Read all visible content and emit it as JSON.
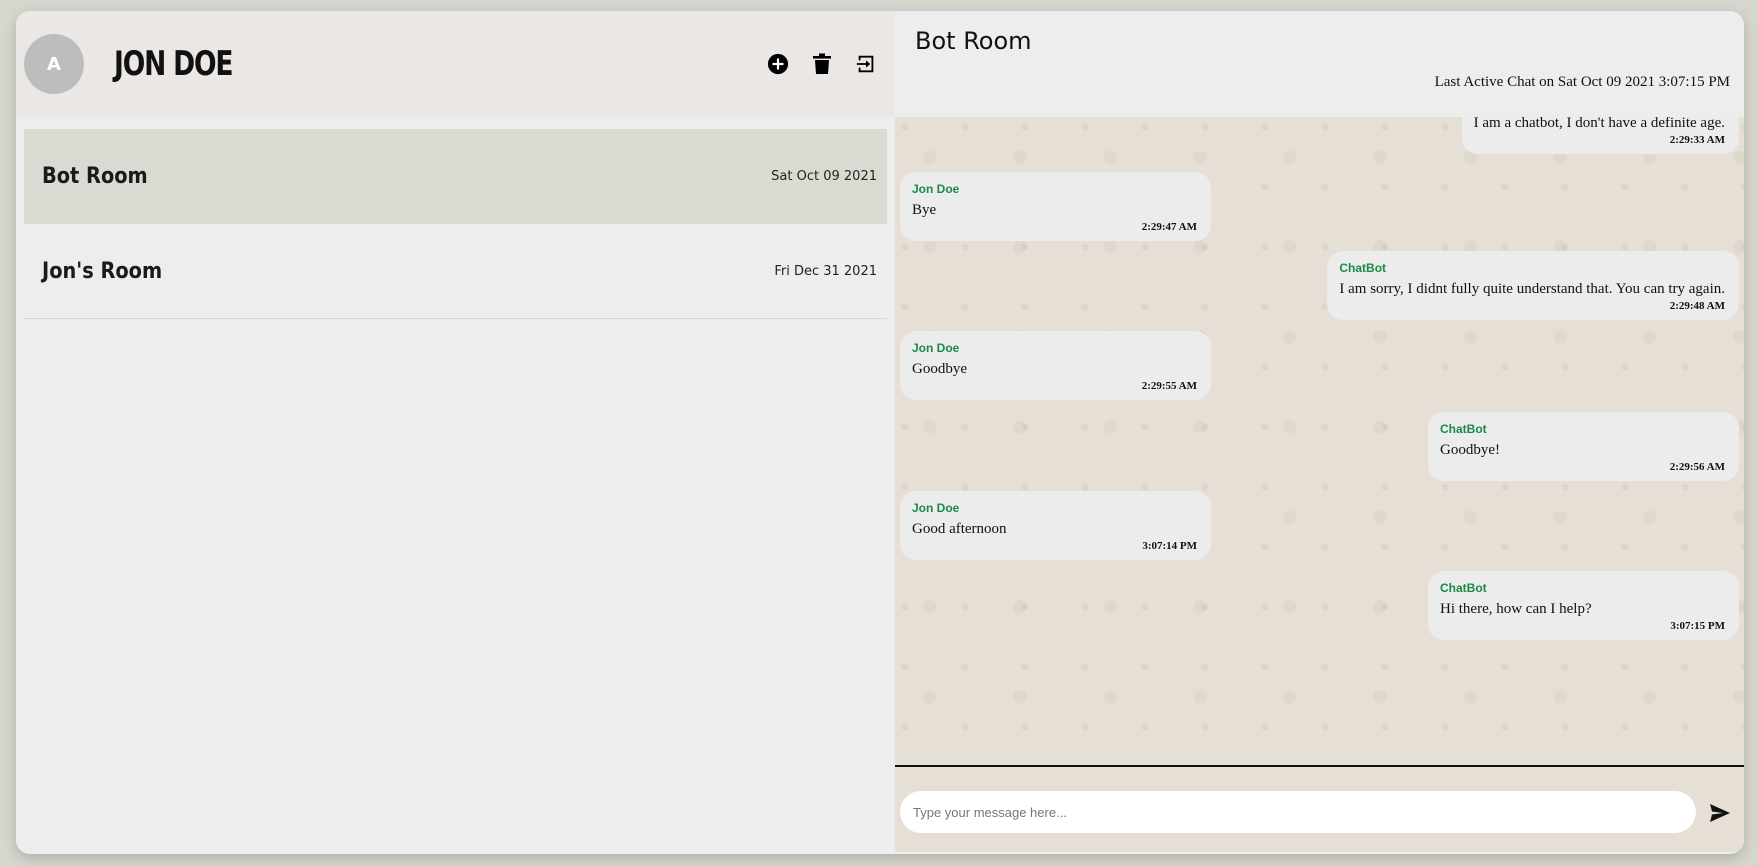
{
  "user": {
    "avatar_letter": "A",
    "name": "JON DOE"
  },
  "header_icons": [
    "add-circle-icon",
    "trash-icon",
    "logout-icon"
  ],
  "rooms": [
    {
      "name": "Bot Room",
      "date": "Sat Oct 09 2021",
      "active": true
    },
    {
      "name": "Jon's Room",
      "date": "Fri Dec 31 2021",
      "active": false
    }
  ],
  "chat": {
    "title": "Bot Room",
    "last_active": "Last Active Chat on Sat Oct 09 2021 3:07:15 PM",
    "messages": [
      {
        "sender": "",
        "text": "I am a chatbot, I don't have a definite age.",
        "time": "2:29:33 AM",
        "side": "right"
      },
      {
        "sender": "Jon Doe",
        "text": "Bye",
        "time": "2:29:47 AM",
        "side": "left"
      },
      {
        "sender": "ChatBot",
        "text": "I am sorry, I didnt fully quite understand that. You can try again.",
        "time": "2:29:48 AM",
        "side": "right"
      },
      {
        "sender": "Jon Doe",
        "text": "Goodbye",
        "time": "2:29:55 AM",
        "side": "left"
      },
      {
        "sender": "ChatBot",
        "text": "Goodbye!",
        "time": "2:29:56 AM",
        "side": "right"
      },
      {
        "sender": "Jon Doe",
        "text": "Good afternoon",
        "time": "3:07:14 PM",
        "side": "left"
      },
      {
        "sender": "ChatBot",
        "text": "Hi there, how can I help?",
        "time": "3:07:15 PM",
        "side": "right"
      }
    ]
  },
  "composer": {
    "placeholder": "Type your message here...",
    "value": ""
  },
  "colors": {
    "sender": "#1b8a44",
    "active_room": "#d9dad2"
  }
}
